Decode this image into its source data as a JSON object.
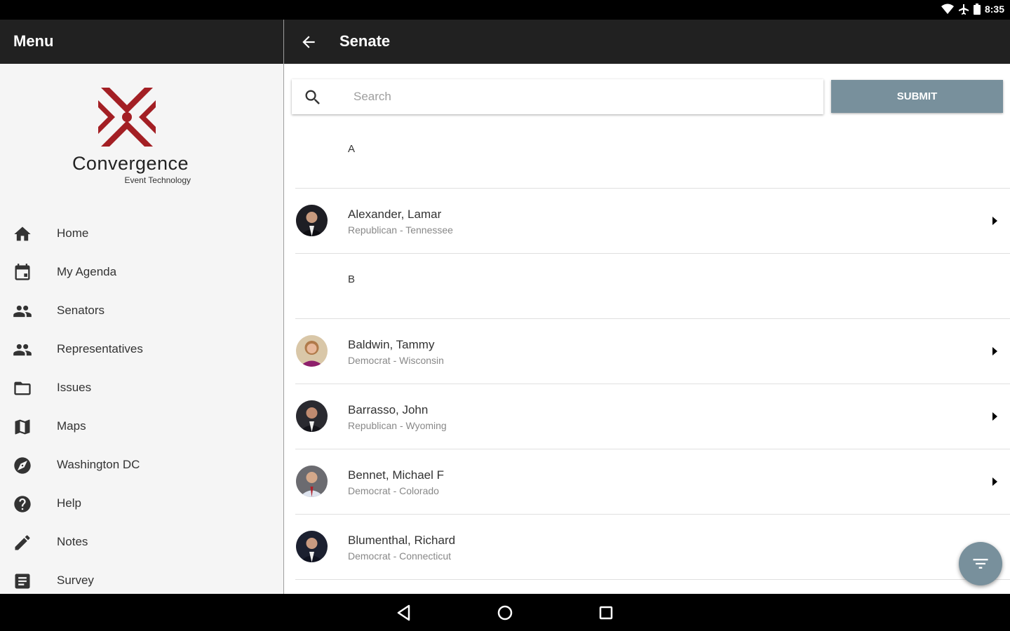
{
  "status": {
    "time": "8:35"
  },
  "sidebar": {
    "title": "Menu",
    "logo": {
      "name": "Convergence",
      "subtitle": "Event Technology"
    },
    "items": [
      {
        "label": "Home",
        "icon": "home-icon"
      },
      {
        "label": "My Agenda",
        "icon": "calendar-icon"
      },
      {
        "label": "Senators",
        "icon": "people-icon"
      },
      {
        "label": "Representatives",
        "icon": "people-icon"
      },
      {
        "label": "Issues",
        "icon": "folder-icon"
      },
      {
        "label": "Maps",
        "icon": "map-icon"
      },
      {
        "label": "Washington DC",
        "icon": "compass-icon"
      },
      {
        "label": "Help",
        "icon": "help-icon"
      },
      {
        "label": "Notes",
        "icon": "pencil-icon"
      },
      {
        "label": "Survey",
        "icon": "list-icon"
      }
    ]
  },
  "main": {
    "title": "Senate",
    "search": {
      "placeholder": "Search",
      "value": ""
    },
    "submit_label": "SUBMIT",
    "sections": [
      {
        "letter": "A",
        "rows": [
          {
            "name": "Alexander, Lamar",
            "sub": "Republican - Tennessee"
          }
        ]
      },
      {
        "letter": "B",
        "rows": [
          {
            "name": "Baldwin, Tammy",
            "sub": "Democrat - Wisconsin"
          },
          {
            "name": "Barrasso, John",
            "sub": "Republican - Wyoming"
          },
          {
            "name": "Bennet, Michael F",
            "sub": "Democrat - Colorado"
          },
          {
            "name": "Blumenthal, Richard",
            "sub": "Democrat - Connecticut"
          }
        ]
      }
    ]
  },
  "colors": {
    "accent": "#78909c",
    "brand": "#a31f24",
    "header": "#212121"
  }
}
